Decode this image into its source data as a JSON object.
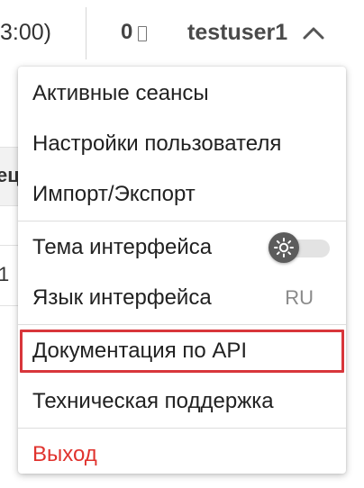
{
  "topbar": {
    "timezone_text": "3:00)",
    "counter_value": "0",
    "counter_icon": "document-icon",
    "username": "testuser1",
    "toggle_icon": "chevron-up-icon"
  },
  "background": {
    "header_fragment": "ец",
    "row_fragment": "1"
  },
  "menu": {
    "items": [
      {
        "label": "Активные сеансы"
      },
      {
        "label": "Настройки пользователя"
      },
      {
        "label": "Импорт/Экспорт"
      },
      {
        "label": "Тема интерфейса",
        "control": "toggle",
        "icon": "sun-icon",
        "toggle_on": false
      },
      {
        "label": "Язык интерфейса",
        "value": "RU"
      },
      {
        "label": "Документация по API",
        "highlighted": true
      },
      {
        "label": "Техническая поддержка"
      },
      {
        "label": "Выход"
      }
    ],
    "highlight_color": "#d8363b",
    "logout_color": "#e0332e"
  }
}
